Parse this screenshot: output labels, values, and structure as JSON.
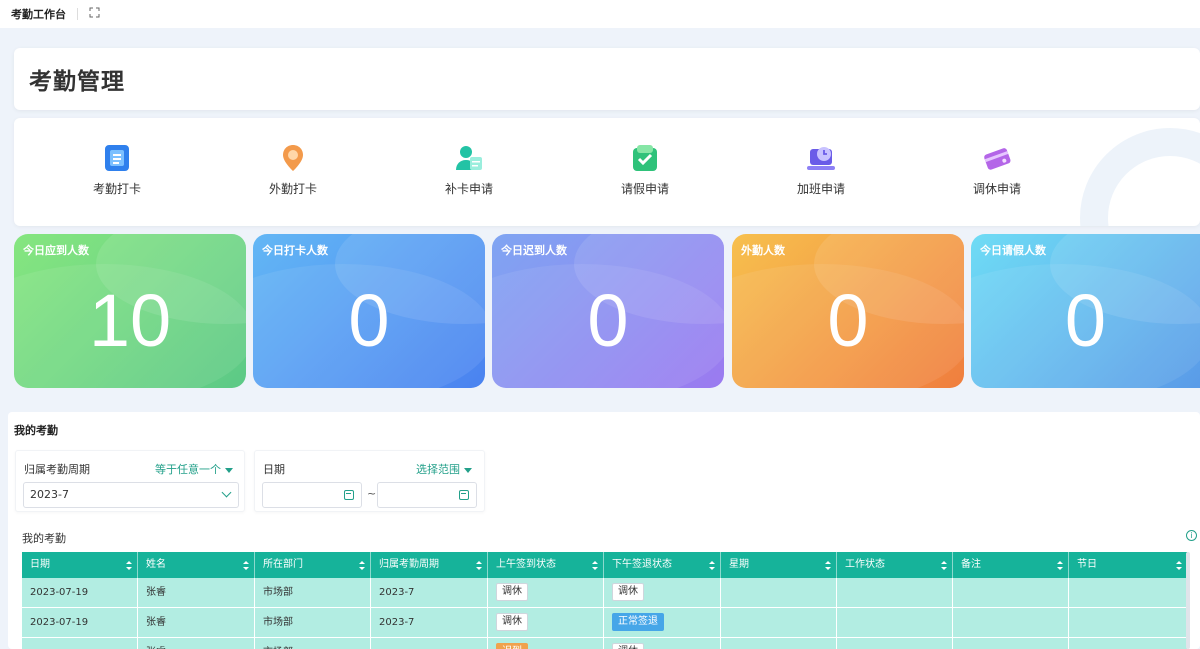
{
  "topbar": {
    "title": "考勤工作台",
    "expand_icon": "expand-icon"
  },
  "header": {
    "title": "考勤管理"
  },
  "actions": [
    {
      "label": "考勤打卡",
      "icon": "document-icon",
      "color": "#2f80ed"
    },
    {
      "label": "外勤打卡",
      "icon": "location-pin-icon",
      "color": "#f39a4b"
    },
    {
      "label": "补卡申请",
      "icon": "user-card-icon",
      "color": "#23c3a5"
    },
    {
      "label": "请假申请",
      "icon": "shield-check-icon",
      "color": "#2fc27a"
    },
    {
      "label": "加班申请",
      "icon": "laptop-clock-icon",
      "color": "#6a5ce8"
    },
    {
      "label": "调休申请",
      "icon": "card-icon",
      "color": "#b466e8"
    }
  ],
  "stats": [
    {
      "label": "今日应到人数",
      "value": "10",
      "from": "#86e680",
      "to": "#5cc986"
    },
    {
      "label": "今日打卡人数",
      "value": "0",
      "from": "#63b7f5",
      "to": "#4a82f0"
    },
    {
      "label": "今日迟到人数",
      "value": "0",
      "from": "#7fa5f2",
      "to": "#9b7af0"
    },
    {
      "label": "外勤人数",
      "value": "0",
      "from": "#f7c04e",
      "to": "#f07e3e"
    },
    {
      "label": "今日请假人数",
      "value": "0",
      "from": "#6fdcf5",
      "to": "#5a9be8"
    }
  ],
  "section": {
    "title": "我的考勤",
    "filters": {
      "period_label": "归属考勤周期",
      "period_operator": "等于任意一个",
      "period_value": "2023-7",
      "date_label": "日期",
      "date_operator": "选择范围",
      "date_separator": "~"
    },
    "table_title": "我的考勤",
    "info_icon": "i"
  },
  "table": {
    "columns": [
      "日期",
      "姓名",
      "所在部门",
      "归属考勤周期",
      "上午签到状态",
      "下午签退状态",
      "星期",
      "工作状态",
      "备注",
      "节日"
    ],
    "rows": [
      [
        "2023-07-19",
        "张睿",
        "市场部",
        "2023-7",
        "调休",
        "调休",
        "",
        "",
        "",
        ""
      ],
      [
        "2023-07-19",
        "张睿",
        "市场部",
        "2023-7",
        "调休",
        "正常签退",
        "",
        "",
        "",
        ""
      ],
      [
        "",
        "张睿",
        "市场部",
        "",
        "迟到",
        "调休",
        "",
        "",
        "",
        ""
      ]
    ]
  }
}
